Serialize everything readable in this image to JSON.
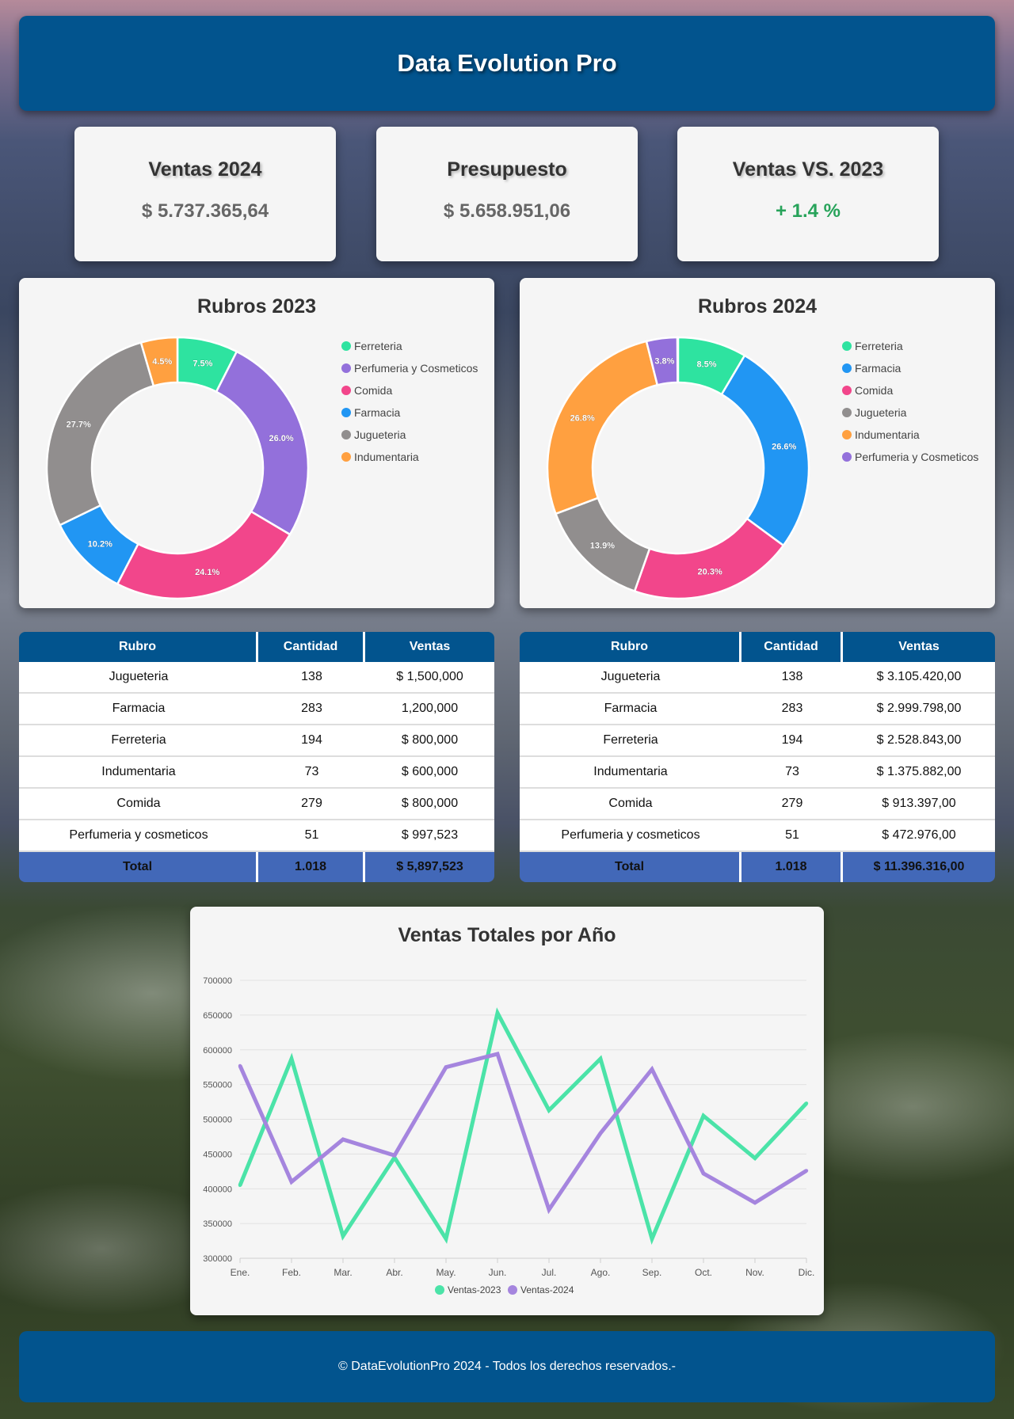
{
  "header": {
    "title": "Data Evolution Pro"
  },
  "kpis": [
    {
      "title": "Ventas 2024",
      "value": "$ 5.737.365,64",
      "color": "#666666"
    },
    {
      "title": "Presupuesto",
      "value": "$ 5.658.951,06",
      "color": "#666666"
    },
    {
      "title": "Ventas VS. 2023",
      "value": "+ 1.4 %",
      "color": "#27a35a"
    }
  ],
  "donut2023": {
    "title": "Rubros 2023",
    "segments": [
      {
        "label": "Ferreteria",
        "pct": 7.5,
        "text": "7.5%",
        "color": "#2ee3a0"
      },
      {
        "label": "Perfumeria y Cosmeticos",
        "pct": 26.0,
        "text": "26.0%",
        "color": "#9370db"
      },
      {
        "label": "Comida",
        "pct": 24.1,
        "text": "24.1%",
        "color": "#f2468b"
      },
      {
        "label": "Farmacia",
        "pct": 10.2,
        "text": "10.2%",
        "color": "#2196f3"
      },
      {
        "label": "Jugueteria",
        "pct": 27.7,
        "text": "27.7%",
        "color": "#918e8e"
      },
      {
        "label": "Indumentaria",
        "pct": 4.5,
        "text": "4.5%",
        "color": "#ffa040"
      }
    ]
  },
  "donut2024": {
    "title": "Rubros 2024",
    "segments": [
      {
        "label": "Ferreteria",
        "pct": 8.5,
        "text": "8.5%",
        "color": "#2ee3a0"
      },
      {
        "label": "Farmacia",
        "pct": 26.6,
        "text": "26.6%",
        "color": "#2196f3"
      },
      {
        "label": "Comida",
        "pct": 20.3,
        "text": "20.3%",
        "color": "#f2468b"
      },
      {
        "label": "Jugueteria",
        "pct": 13.9,
        "text": "13.9%",
        "color": "#918e8e"
      },
      {
        "label": "Indumentaria",
        "pct": 26.8,
        "text": "26.8%",
        "color": "#ffa040"
      },
      {
        "label": "Perfumeria y Cosmeticos",
        "pct": 3.8,
        "text": "3.8%",
        "color": "#9370db"
      }
    ]
  },
  "table2023": {
    "headers": [
      "Rubro",
      "Cantidad",
      "Ventas"
    ],
    "rows": [
      [
        "Jugueteria",
        "138",
        "$ 1,500,000"
      ],
      [
        "Farmacia",
        "283",
        "1,200,000"
      ],
      [
        "Ferreteria",
        "194",
        "$ 800,000"
      ],
      [
        "Indumentaria",
        "73",
        "$ 600,000"
      ],
      [
        "Comida",
        "279",
        "$ 800,000"
      ],
      [
        "Perfumeria y cosmeticos",
        "51",
        "$ 997,523"
      ]
    ],
    "total": [
      "Total",
      "1.018",
      "$ 5,897,523"
    ]
  },
  "table2024": {
    "headers": [
      "Rubro",
      "Cantidad",
      "Ventas"
    ],
    "rows": [
      [
        "Jugueteria",
        "138",
        "$ 3.105.420,00"
      ],
      [
        "Farmacia",
        "283",
        "$ 2.999.798,00"
      ],
      [
        "Ferreteria",
        "194",
        "$ 2.528.843,00"
      ],
      [
        "Indumentaria",
        "73",
        "$ 1.375.882,00"
      ],
      [
        "Comida",
        "279",
        "$ 913.397,00"
      ],
      [
        "Perfumeria y cosmeticos",
        "51",
        "$ 472.976,00"
      ]
    ],
    "total": [
      "Total",
      "1.018",
      "$ 11.396.316,00"
    ]
  },
  "chart_data": [
    {
      "type": "pie",
      "title": "Rubros 2023",
      "categories": [
        "Ferreteria",
        "Perfumeria y Cosmeticos",
        "Comida",
        "Farmacia",
        "Jugueteria",
        "Indumentaria"
      ],
      "values": [
        7.5,
        26.0,
        24.1,
        10.2,
        27.7,
        4.5
      ],
      "legend": "right"
    },
    {
      "type": "pie",
      "title": "Rubros 2024",
      "categories": [
        "Ferreteria",
        "Farmacia",
        "Comida",
        "Jugueteria",
        "Indumentaria",
        "Perfumeria y Cosmeticos"
      ],
      "values": [
        8.5,
        26.6,
        20.3,
        13.9,
        26.8,
        3.8
      ],
      "legend": "right"
    },
    {
      "type": "line",
      "title": "Ventas Totales por Año",
      "categories": [
        "Ene.",
        "Feb.",
        "Mar.",
        "Abr.",
        "May.",
        "Jun.",
        "Jul.",
        "Ago.",
        "Sep.",
        "Oct.",
        "Nov.",
        "Dic."
      ],
      "series": [
        {
          "name": "Ventas-2023",
          "color": "#4be3a8",
          "values": [
            405000,
            587000,
            332000,
            445000,
            328000,
            653000,
            513000,
            587000,
            328000,
            505000,
            444000,
            523000
          ]
        },
        {
          "name": "Ventas-2024",
          "color": "#a585de",
          "values": [
            577000,
            410000,
            471000,
            448000,
            575000,
            594000,
            370000,
            480000,
            572000,
            422000,
            380000,
            426000
          ]
        }
      ],
      "ylim": [
        300000,
        700000
      ],
      "yticks": [
        "700000",
        "650000",
        "600000",
        "550000",
        "500000",
        "450000",
        "400000",
        "350000",
        "300000"
      ],
      "grid": true,
      "legend": "bottom"
    }
  ],
  "footer": {
    "text": "© DataEvolutionPro 2024 - Todos los derechos reservados.-"
  }
}
